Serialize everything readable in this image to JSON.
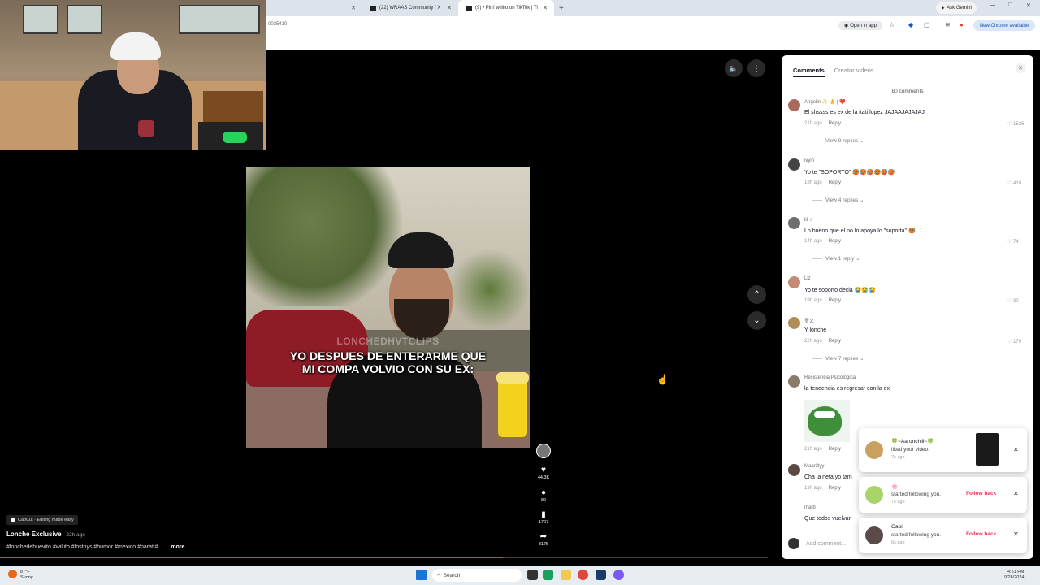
{
  "browser": {
    "tabs": [
      {
        "title": ""
      },
      {
        "title": "(22) WRAAS Community / X"
      },
      {
        "title": "(9) • Pini’ willito on TikTok | Ti"
      }
    ],
    "new_tab": "+",
    "ask_gemini": "Ask Gemini",
    "address": "0035410",
    "open_in_app": "Open in app",
    "new_chrome": "New Chrome available",
    "win_min": "—",
    "win_max": "□",
    "win_close": "✕"
  },
  "video": {
    "watermark": "LONCHEDHVTCLIPS",
    "caption_line1": "YO DESPUES DE ENTERARME QUE",
    "caption_line2": "MI COMPA VOLVIO CON SU EX:",
    "likes": "44.3K",
    "comments": "80",
    "saves": "1707",
    "shares": "3175",
    "progress_fraction": 0.655
  },
  "info": {
    "capcut": "CapCut · Editing made easy",
    "author": "Lonche Exclusive",
    "time": " · 22h ago",
    "tags": "#lonchedehuevito #willito #lostoys #humor #mexico #parati#...",
    "more": "more"
  },
  "panel": {
    "tab_comments": "Comments",
    "tab_creator": "Creator videos",
    "count": "80 comments",
    "add_comment": "Add comment...",
    "comments": [
      {
        "user": "Angelin ✨ 👌 | ❤️",
        "text": "El shssss es ex de la itati lopez JAJAAJAJAJAJ",
        "time": "21h ago",
        "reply": "Reply",
        "likes": "♡ 1536",
        "view_replies": "View 9 replies ⌄"
      },
      {
        "user": "ivyih",
        "text": "Yo te \"SOPORTO\" 🥵🥵🥵🥵🥵🥵",
        "time": "18h ago",
        "reply": "Reply",
        "likes": "♡ 410",
        "view_replies": "View 4 replies ⌄"
      },
      {
        "user": "lil ☆",
        "text": "Lo bueno que el no lo apoya lo \"soporta\" 🥵",
        "time": "14h ago",
        "reply": "Reply",
        "likes": "♡ 74",
        "view_replies": "View 1 reply ⌄"
      },
      {
        "user": "Liz",
        "text": "Yo te soporto decia 😭😭😭",
        "time": "19h ago",
        "reply": "Reply",
        "likes": "♡ 30",
        "view_replies": ""
      },
      {
        "user": "罗文",
        "text": "Y lonche",
        "time": "22h ago",
        "reply": "Reply",
        "likes": "♡ 179",
        "view_replies": "View 7 replies ⌄"
      },
      {
        "user": "Resistencia Psicológica.",
        "text": "la tendencia es regresar con la ex",
        "time": "21h ago",
        "reply": "Reply",
        "likes": "",
        "view_replies": ""
      },
      {
        "user": "Maar3lyy",
        "text": "Cha la neta yo tam",
        "time": "19h ago",
        "reply": "Reply",
        "likes": "",
        "view_replies": ""
      },
      {
        "user": "marb",
        "text": "Que todos vuelvan",
        "time": "",
        "reply": "",
        "likes": "",
        "view_replies": ""
      }
    ]
  },
  "notifications": [
    {
      "user": "🍀~Aaronchill~🍀",
      "msg": "liked your video.",
      "time": "7s ago",
      "follow": ""
    },
    {
      "user": "🌸",
      "msg": "started following you.",
      "time": "7s ago",
      "follow": "Follow back"
    },
    {
      "user": "Gabi",
      "msg": "started following you.",
      "time": "6s ago",
      "follow": "Follow back"
    }
  ],
  "taskbar": {
    "weather_temp": "87°F",
    "weather_desc": "Sunny",
    "search": "Search",
    "time": "4:51 PM",
    "date": "9/26/2024"
  }
}
